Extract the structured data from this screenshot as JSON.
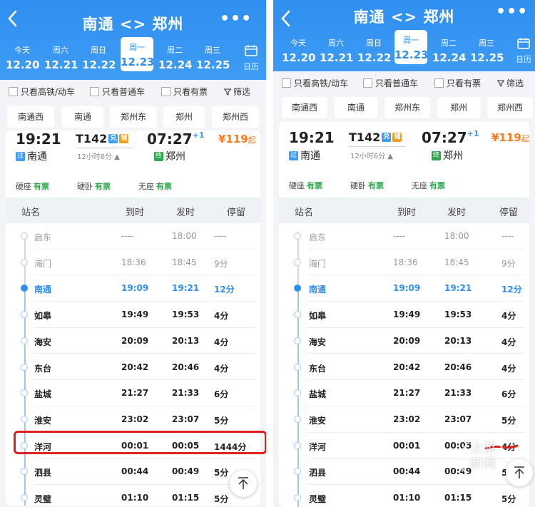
{
  "header": {
    "title": "南通 <> 郑州",
    "more": "•••",
    "back_icon": "chevron-left-icon"
  },
  "dates": [
    {
      "weekday": "今天",
      "date": "12.20"
    },
    {
      "weekday": "周六",
      "date": "12.21"
    },
    {
      "weekday": "周日",
      "date": "12.22"
    },
    {
      "weekday": "周一",
      "date": "12.23",
      "selected": true
    },
    {
      "weekday": "周二",
      "date": "12.24"
    },
    {
      "weekday": "周三",
      "date": "12.25"
    }
  ],
  "calendar_label": "日历",
  "filters": {
    "high_speed": "只看高铁/动车",
    "normal": "只看普通车",
    "available": "只看有票",
    "screen": "筛选"
  },
  "stations": [
    "南通西",
    "南通",
    "郑州东",
    "郑州",
    "郑州西"
  ],
  "train": {
    "depart_time": "19:21",
    "depart_station": "南通",
    "depart_badge": "过",
    "number": "T142",
    "tag1": "兑",
    "tag2": "铺",
    "duration": "12小时6分",
    "arrive_time": "07:27",
    "arrive_plus": "+1",
    "arrive_station": "郑州",
    "arrive_badge": "终",
    "price": "¥119",
    "price_suffix": "起"
  },
  "seats": [
    {
      "type": "硬座",
      "status": "有票"
    },
    {
      "type": "硬卧",
      "status": "有票"
    },
    {
      "type": "无座",
      "status": "有票"
    }
  ],
  "table_headers": {
    "station": "站名",
    "arrive": "到时",
    "depart": "发时",
    "stop": "停留"
  },
  "stops": [
    {
      "name": "启东",
      "arrive": "----",
      "depart": "18:00",
      "stop": "----",
      "state": "passed"
    },
    {
      "name": "海门",
      "arrive": "18:36",
      "depart": "18:45",
      "stop": "9分",
      "state": "passed"
    },
    {
      "name": "南通",
      "arrive": "19:09",
      "depart": "19:21",
      "stop": "12分",
      "state": "current"
    },
    {
      "name": "如皋",
      "arrive": "19:49",
      "depart": "19:53",
      "stop": "4分",
      "state": "future"
    },
    {
      "name": "海安",
      "arrive": "20:09",
      "depart": "20:13",
      "stop": "4分",
      "state": "future"
    },
    {
      "name": "东台",
      "arrive": "20:42",
      "depart": "20:46",
      "stop": "4分",
      "state": "future"
    },
    {
      "name": "盐城",
      "arrive": "21:27",
      "depart": "21:33",
      "stop": "6分",
      "state": "future"
    },
    {
      "name": "淮安",
      "arrive": "23:02",
      "depart": "23:07",
      "stop": "5分",
      "state": "future"
    },
    {
      "name": "洋河",
      "arrive": "00:01",
      "depart": "00:05",
      "stop": "1444分",
      "state": "future"
    },
    {
      "name": "泗县",
      "arrive": "00:44",
      "depart": "00:49",
      "stop": "5分",
      "state": "future"
    },
    {
      "name": "灵璧",
      "arrive": "01:10",
      "depart": "01:15",
      "stop": "5分",
      "state": "future"
    }
  ],
  "stops_right_override": {
    "洋河": "4分"
  },
  "watermark": "上游\n新闻",
  "colors": {
    "header": "#2f8ff0",
    "current": "#2f8ff0",
    "available": "#2ca84a",
    "price": "#ff7a1a",
    "highlight": "#e02020"
  }
}
